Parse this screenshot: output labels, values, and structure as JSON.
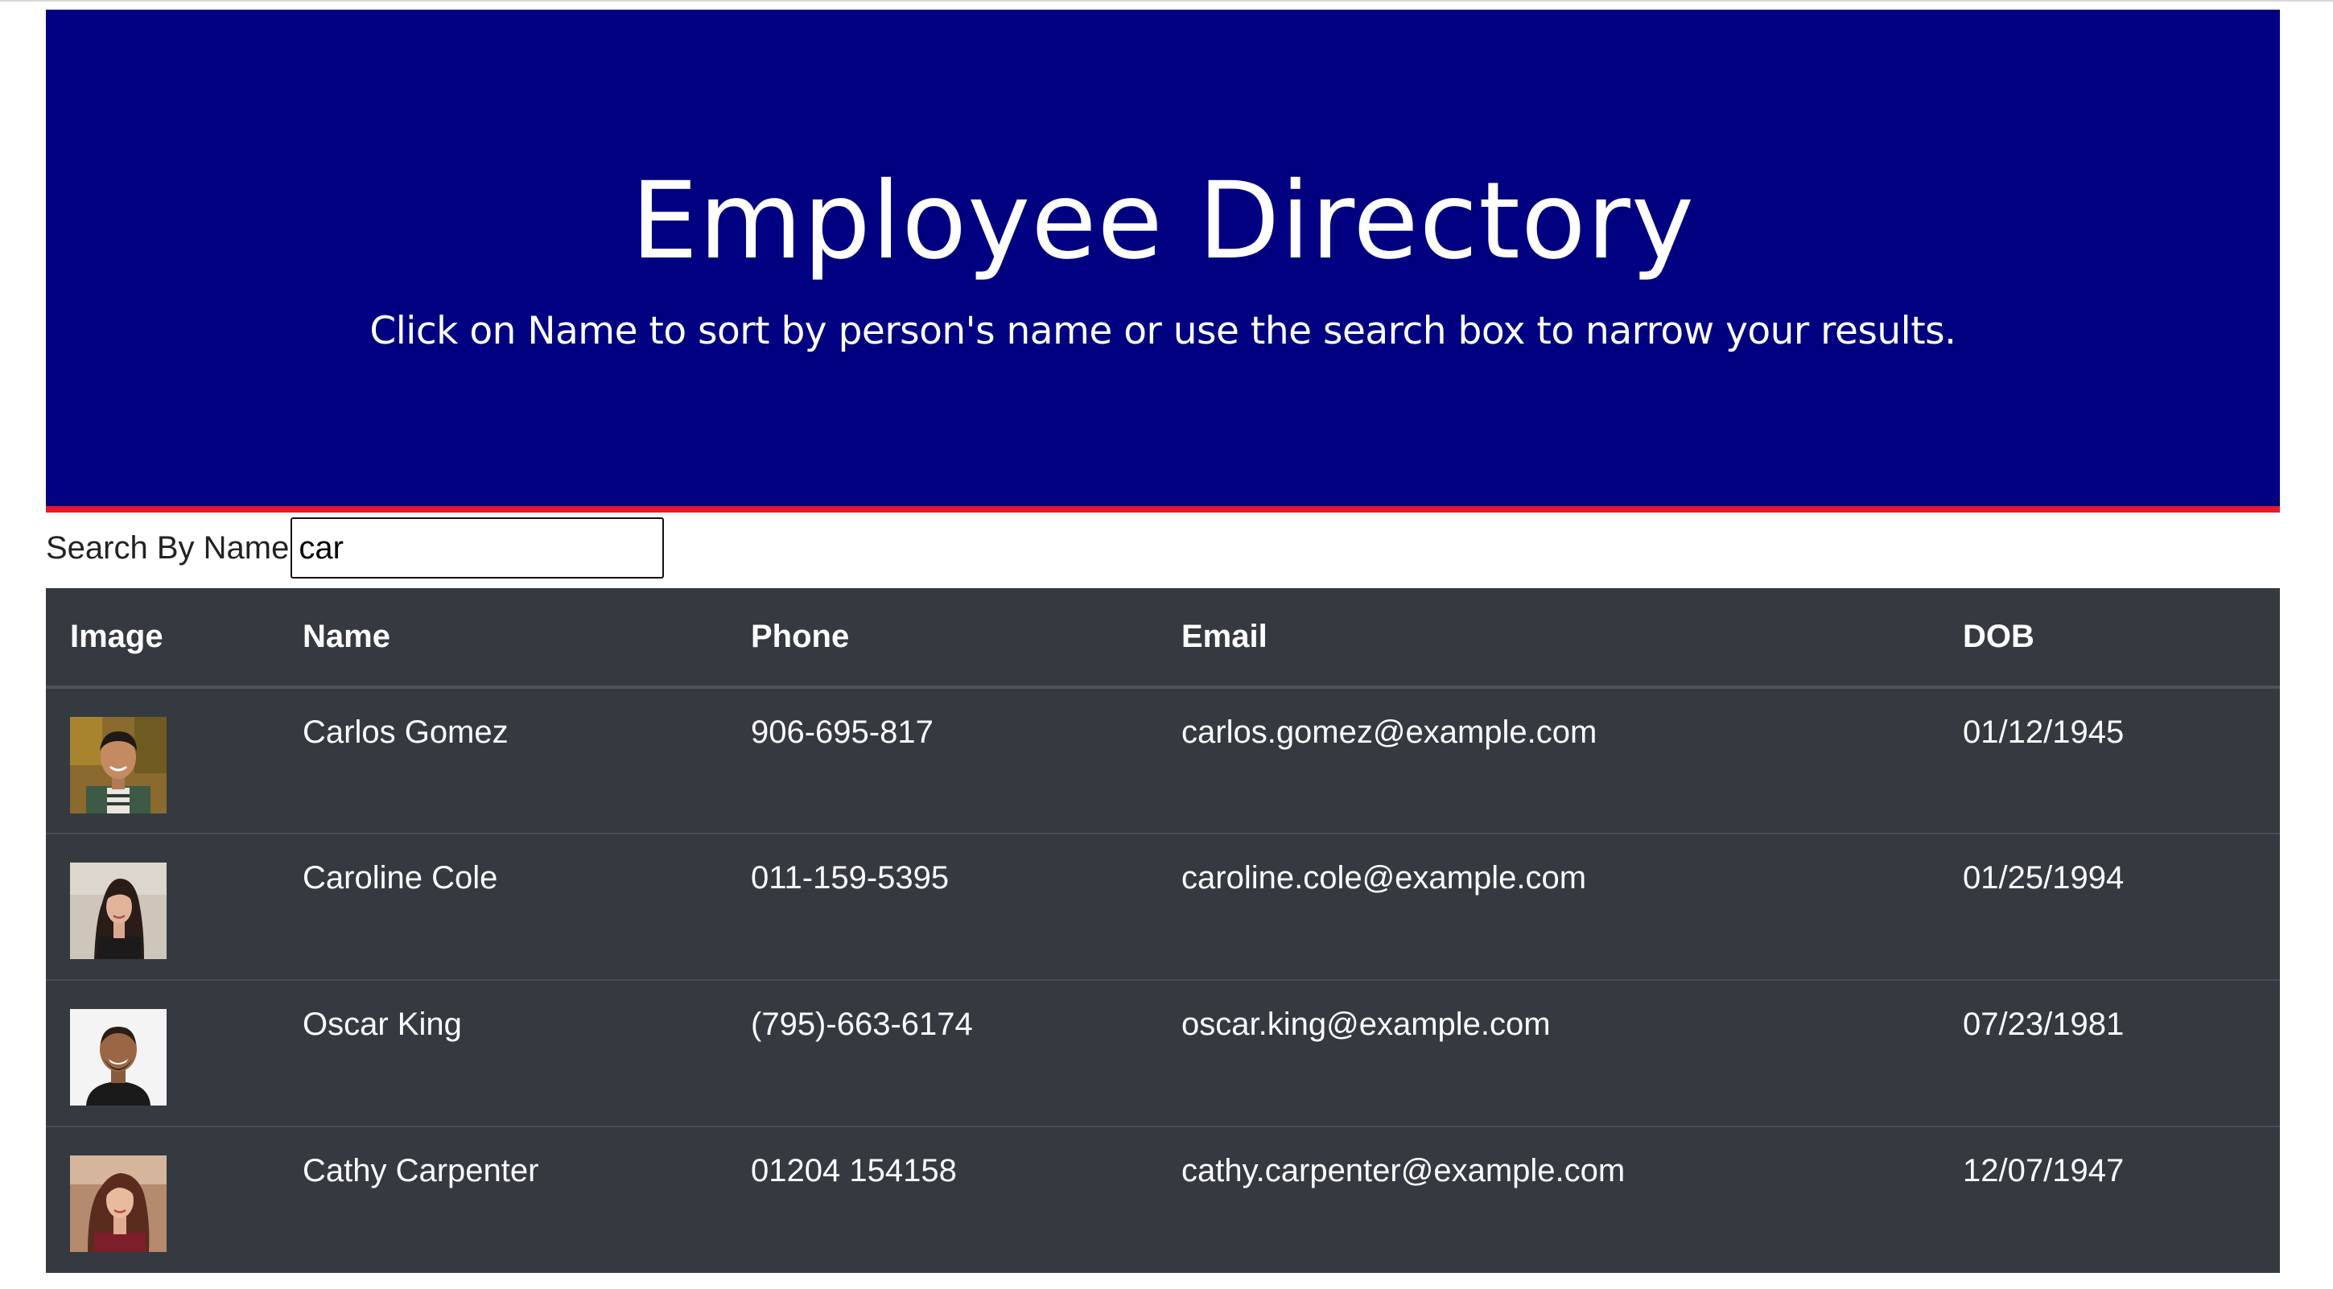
{
  "header": {
    "title": "Employee Directory",
    "subtitle": "Click on Name to sort by person's name or use the search box to narrow your results."
  },
  "search": {
    "label": "Search By Name",
    "value": "car"
  },
  "table": {
    "columns": [
      "Image",
      "Name",
      "Phone",
      "Email",
      "DOB"
    ],
    "rows": [
      {
        "name": "Carlos Gomez",
        "phone": "906-695-817",
        "email": "carlos.gomez@example.com",
        "dob": "01/12/1945"
      },
      {
        "name": "Caroline Cole",
        "phone": "011-159-5395",
        "email": "caroline.cole@example.com",
        "dob": "01/25/1994"
      },
      {
        "name": "Oscar King",
        "phone": "(795)-663-6174",
        "email": "oscar.king@example.com",
        "dob": "07/23/1981"
      },
      {
        "name": "Cathy Carpenter",
        "phone": "01204 154158",
        "email": "cathy.carpenter@example.com",
        "dob": "12/07/1947"
      }
    ]
  },
  "colors": {
    "hero_background": "#000080",
    "hero_border": "#e8192c",
    "table_background": "#343a40"
  }
}
